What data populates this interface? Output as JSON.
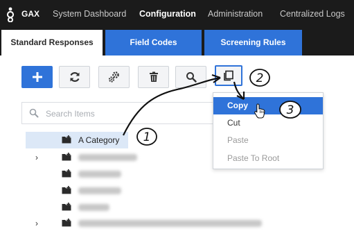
{
  "app": {
    "logo_text": "GAX"
  },
  "nav": {
    "items": [
      {
        "label": "System Dashboard",
        "active": false
      },
      {
        "label": "Configuration",
        "active": true
      },
      {
        "label": "Administration",
        "active": false
      },
      {
        "label": "Centralized Logs",
        "active": false
      }
    ]
  },
  "tabs": [
    {
      "label": "Standard Responses",
      "active": true
    },
    {
      "label": "Field Codes",
      "active": false
    },
    {
      "label": "Screening Rules",
      "active": false
    }
  ],
  "toolbar": {
    "buttons": [
      "plus-icon",
      "refresh-icon",
      "settings-icon",
      "trash-icon",
      "search-icon",
      "copy-icon"
    ]
  },
  "search": {
    "placeholder": "Search Items",
    "value": ""
  },
  "tree": {
    "selected_label": "A Category"
  },
  "context_menu": {
    "items": [
      {
        "label": "Copy",
        "state": "active"
      },
      {
        "label": "Cut",
        "state": "enabled"
      },
      {
        "label": "Paste",
        "state": "disabled"
      },
      {
        "label": "Paste To Root",
        "state": "disabled"
      }
    ]
  },
  "callouts": [
    "1",
    "2",
    "3"
  ],
  "colors": {
    "accent": "#2f73d9",
    "nav_bg": "#1b1b1b",
    "selected_row": "#dce8f7"
  }
}
